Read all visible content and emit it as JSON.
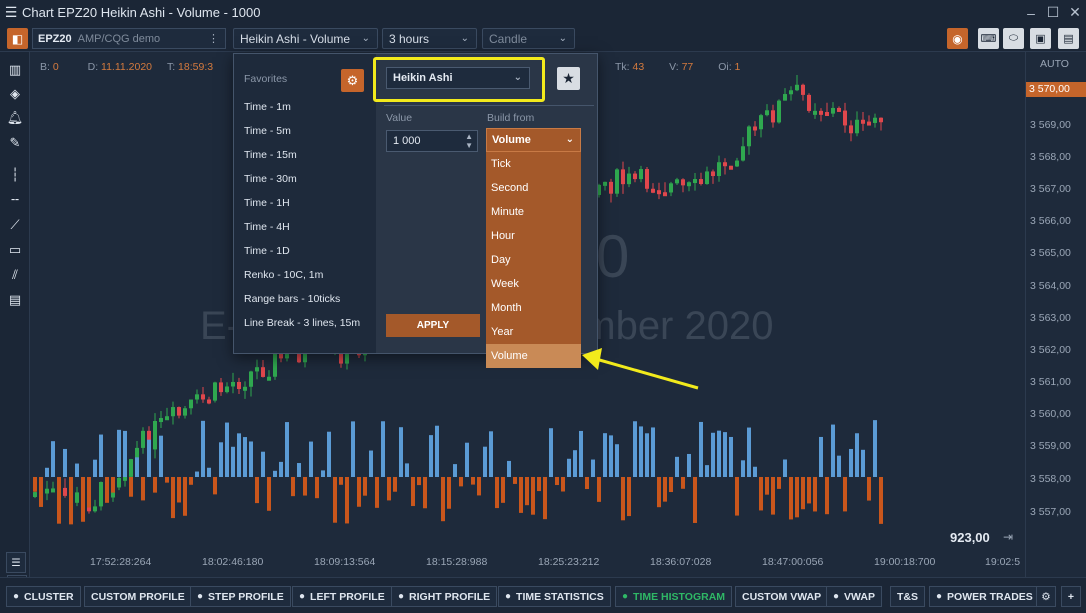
{
  "window": {
    "title": "Chart EPZ20 Heikin Ashi - Volume - 1000"
  },
  "toolbar": {
    "symbol": "EPZ20",
    "account": "AMP/CQG demo",
    "chart_type": "Heikin Ashi - Volume",
    "period": "3 hours",
    "style": "Candle"
  },
  "info": {
    "b_label": "B:",
    "b_value": "0",
    "d_label": "D:",
    "d_value": "11.11.2020",
    "t_label": "T:",
    "t_value": "18:59:3",
    "tk_label": "Tk:",
    "tk_value": "43",
    "v_label": "V:",
    "v_value": "77",
    "oi_label": "Oi:",
    "oi_value": "1"
  },
  "yaxis": {
    "auto": "AUTO",
    "current": "3 570,00",
    "labels": [
      "3 569,00",
      "3 568,00",
      "3 567,00",
      "3 566,00",
      "3 565,00",
      "3 564,00",
      "3 563,00",
      "3 562,00",
      "3 561,00",
      "3 560,00",
      "3 559,00",
      "3 558,00",
      "3 557,00"
    ]
  },
  "xaxis": {
    "labels": [
      "17:52:28:264",
      "18:02:46:180",
      "18:09:13:564",
      "18:15:28:988",
      "18:25:23:212",
      "18:36:07:028",
      "18:47:00:056",
      "19:00:18:700",
      "19:02:5"
    ]
  },
  "watermark": {
    "line1": "0",
    "line2": "E-",
    "line3": "cember 2020"
  },
  "price_badge": "923,00",
  "popup": {
    "favorites_title": "Favorites",
    "favorites": [
      "Time - 1m",
      "Time - 5m",
      "Time - 15m",
      "Time - 30m",
      "Time - 1H",
      "Time - 4H",
      "Time - 1D",
      "Renko - 10C, 1m",
      "Range bars - 10ticks",
      "Line Break - 3 lines, 15m"
    ],
    "bar_type": "Heikin Ashi",
    "value_label": "Value",
    "value": "1 000",
    "build_from_label": "Build from",
    "build_from_selected": "Volume",
    "build_from_options": [
      "Tick",
      "Second",
      "Minute",
      "Hour",
      "Day",
      "Week",
      "Month",
      "Year",
      "Volume"
    ],
    "apply": "APPLY"
  },
  "bottom": {
    "buttons": [
      "CLUSTER",
      "CUSTOM PROFILE",
      "STEP PROFILE",
      "LEFT PROFILE",
      "RIGHT PROFILE",
      "TIME STATISTICS",
      "TIME HISTOGRAM",
      "CUSTOM VWAP",
      "VWAP",
      "T&S",
      "POWER TRADES"
    ]
  },
  "colors": {
    "accent": "#c5652b",
    "bull": "#2fa84f",
    "bear": "#e0474c",
    "vol_up": "#5b9bd5",
    "vol_down": "#c9561c",
    "highlight": "#f2ea1c",
    "active_tab": "#2fb866"
  },
  "icons": [
    "menu-icon",
    "minimize-icon",
    "maximize-icon",
    "close-icon",
    "chart-icon",
    "layers-icon",
    "bell-icon",
    "pencil-icon",
    "vertical-line-icon",
    "horizontal-line-icon",
    "trend-line-icon",
    "rectangle-icon",
    "fib-icon",
    "template-icon",
    "trash-icon",
    "list-icon",
    "gear-icon",
    "star-icon",
    "plus-icon"
  ]
}
